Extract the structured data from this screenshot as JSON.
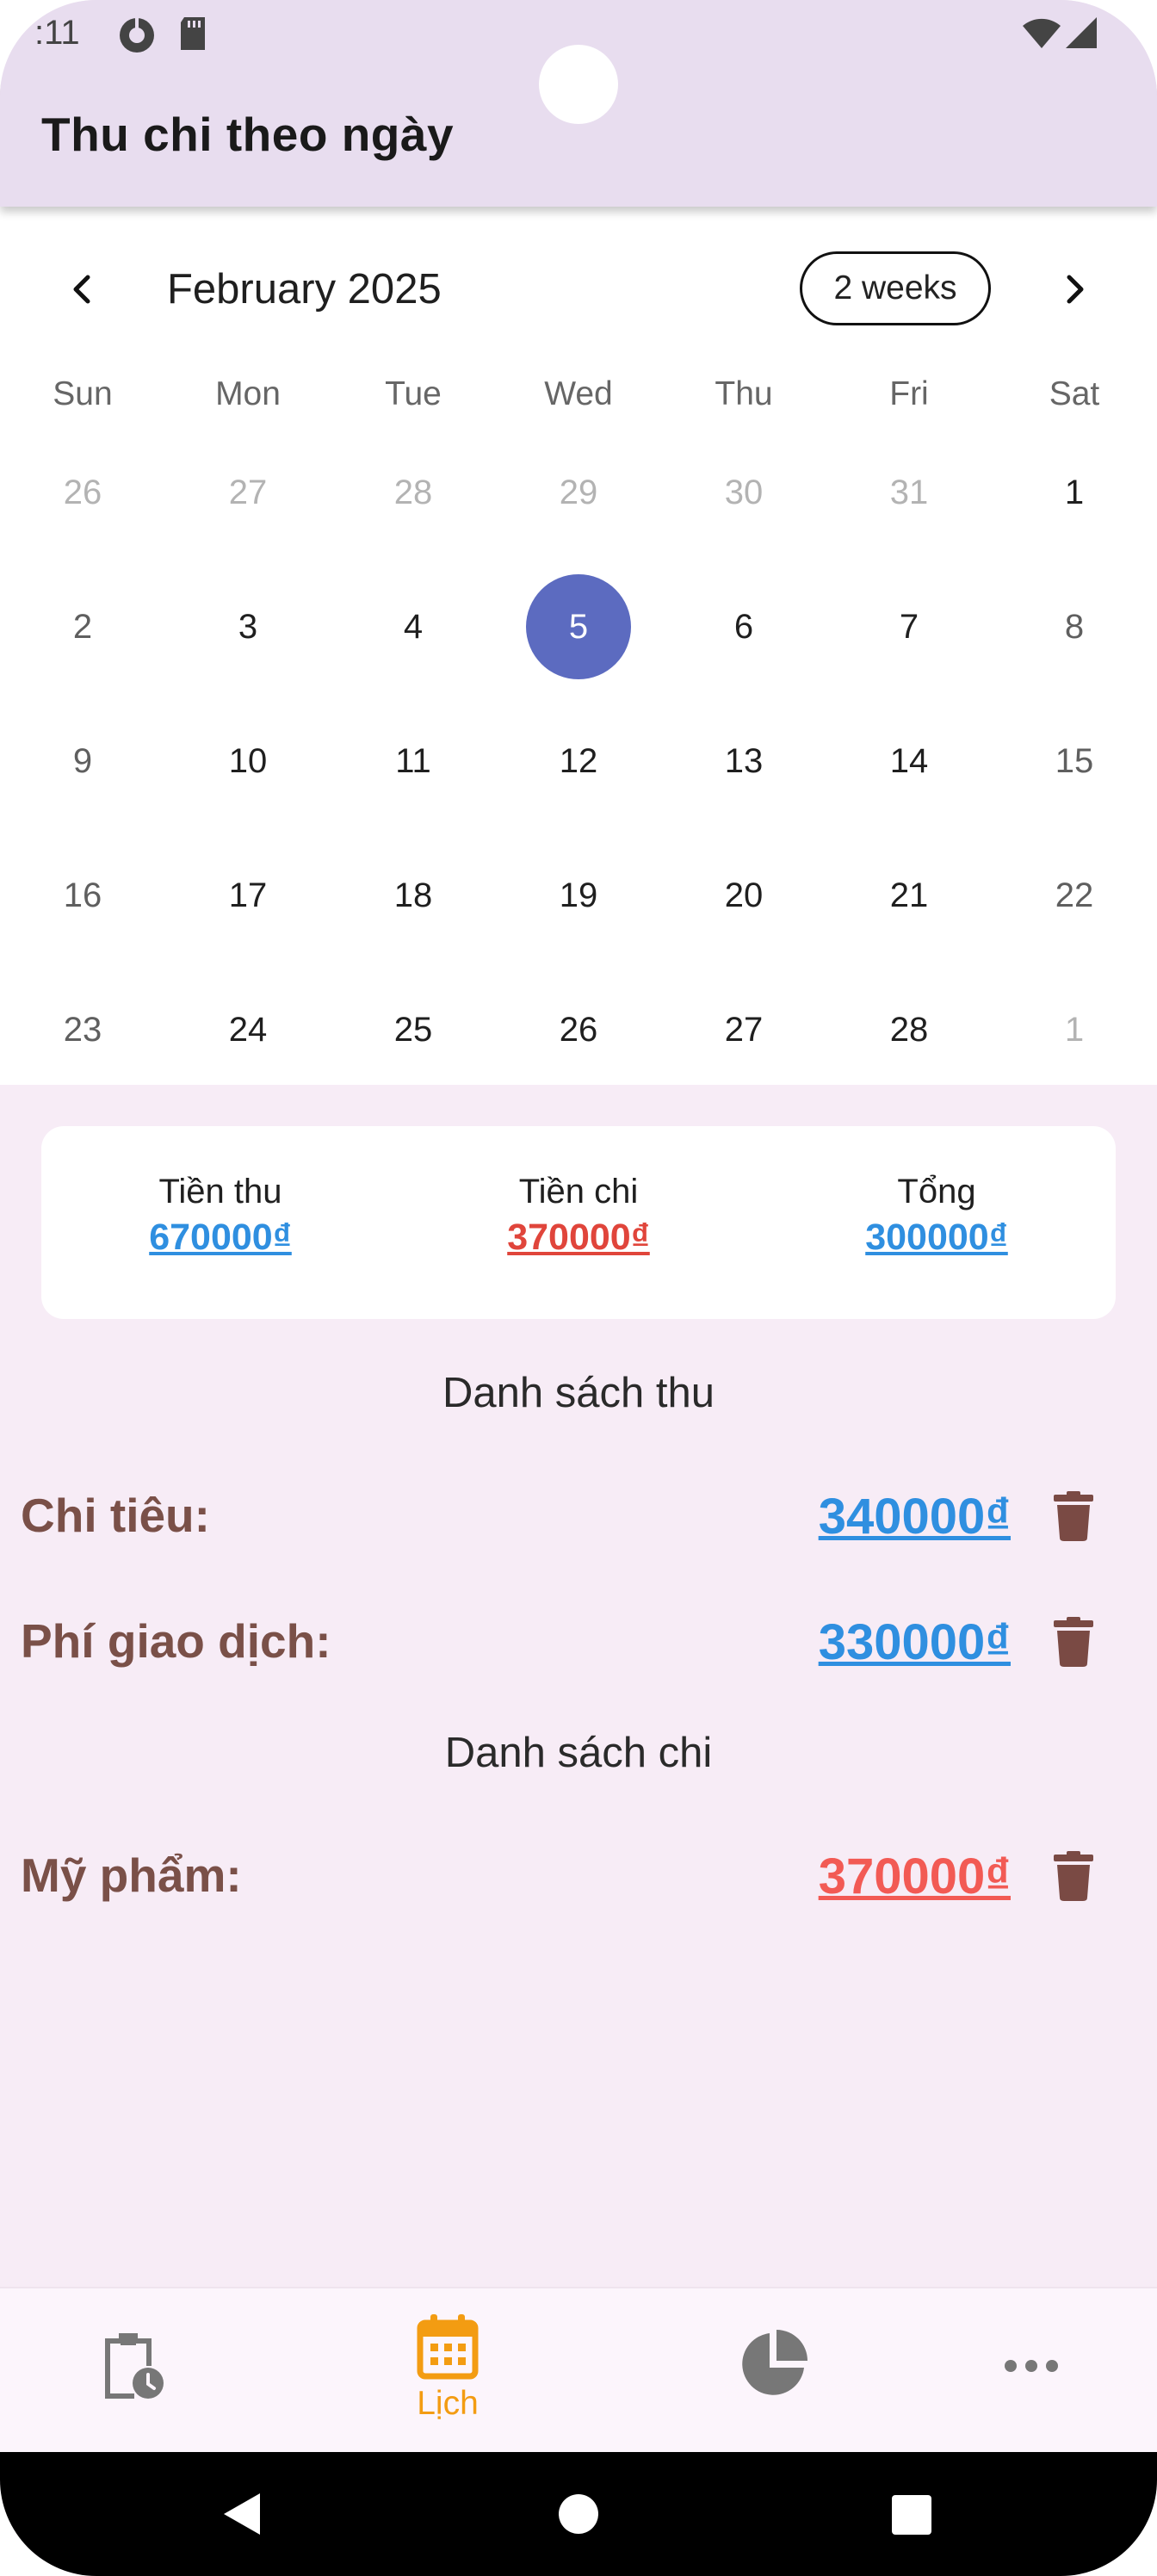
{
  "status_bar": {
    "time": ":11"
  },
  "app_bar": {
    "title": "Thu chi theo ngày"
  },
  "calendar": {
    "month_title": "February 2025",
    "format_button": "2 weeks",
    "weekdays": [
      "Sun",
      "Mon",
      "Tue",
      "Wed",
      "Thu",
      "Fri",
      "Sat"
    ],
    "weeks": [
      [
        "26",
        "27",
        "28",
        "29",
        "30",
        "31",
        "1"
      ],
      [
        "2",
        "3",
        "4",
        "5",
        "6",
        "7",
        "8"
      ],
      [
        "9",
        "10",
        "11",
        "12",
        "13",
        "14",
        "15"
      ],
      [
        "16",
        "17",
        "18",
        "19",
        "20",
        "21",
        "22"
      ],
      [
        "23",
        "24",
        "25",
        "26",
        "27",
        "28",
        "1"
      ]
    ],
    "selected_day": "5",
    "selected_color": "#5c6bc0"
  },
  "summary": {
    "income_label": "Tiền thu",
    "income_value": "670000₫",
    "expense_label": "Tiền chi",
    "expense_value": "370000₫",
    "total_label": "Tổng",
    "total_value": "300000₫"
  },
  "colors": {
    "income": "#2f8fe0",
    "expense": "#e0453b",
    "expense_list": "#f25a54",
    "category_text": "#7a5048",
    "trash": "#7a4a44",
    "nav_active": "#f39c12"
  },
  "income_list": {
    "title": "Danh sách thu",
    "items": [
      {
        "name": "Chi tiêu:",
        "amount": "340000₫"
      },
      {
        "name": "Phí giao dịch:",
        "amount": "330000₫"
      }
    ]
  },
  "expense_list": {
    "title": "Danh sách chi",
    "items": [
      {
        "name": "Mỹ phẩm:",
        "amount": "370000₫"
      }
    ]
  },
  "bottom_nav": {
    "items": [
      {
        "icon": "clipboard-clock-icon",
        "label": ""
      },
      {
        "icon": "calendar-icon",
        "label": "Lịch"
      },
      {
        "icon": "pie-chart-icon",
        "label": ""
      },
      {
        "icon": "more-dots-icon",
        "label": ""
      }
    ],
    "active_index": 1
  }
}
